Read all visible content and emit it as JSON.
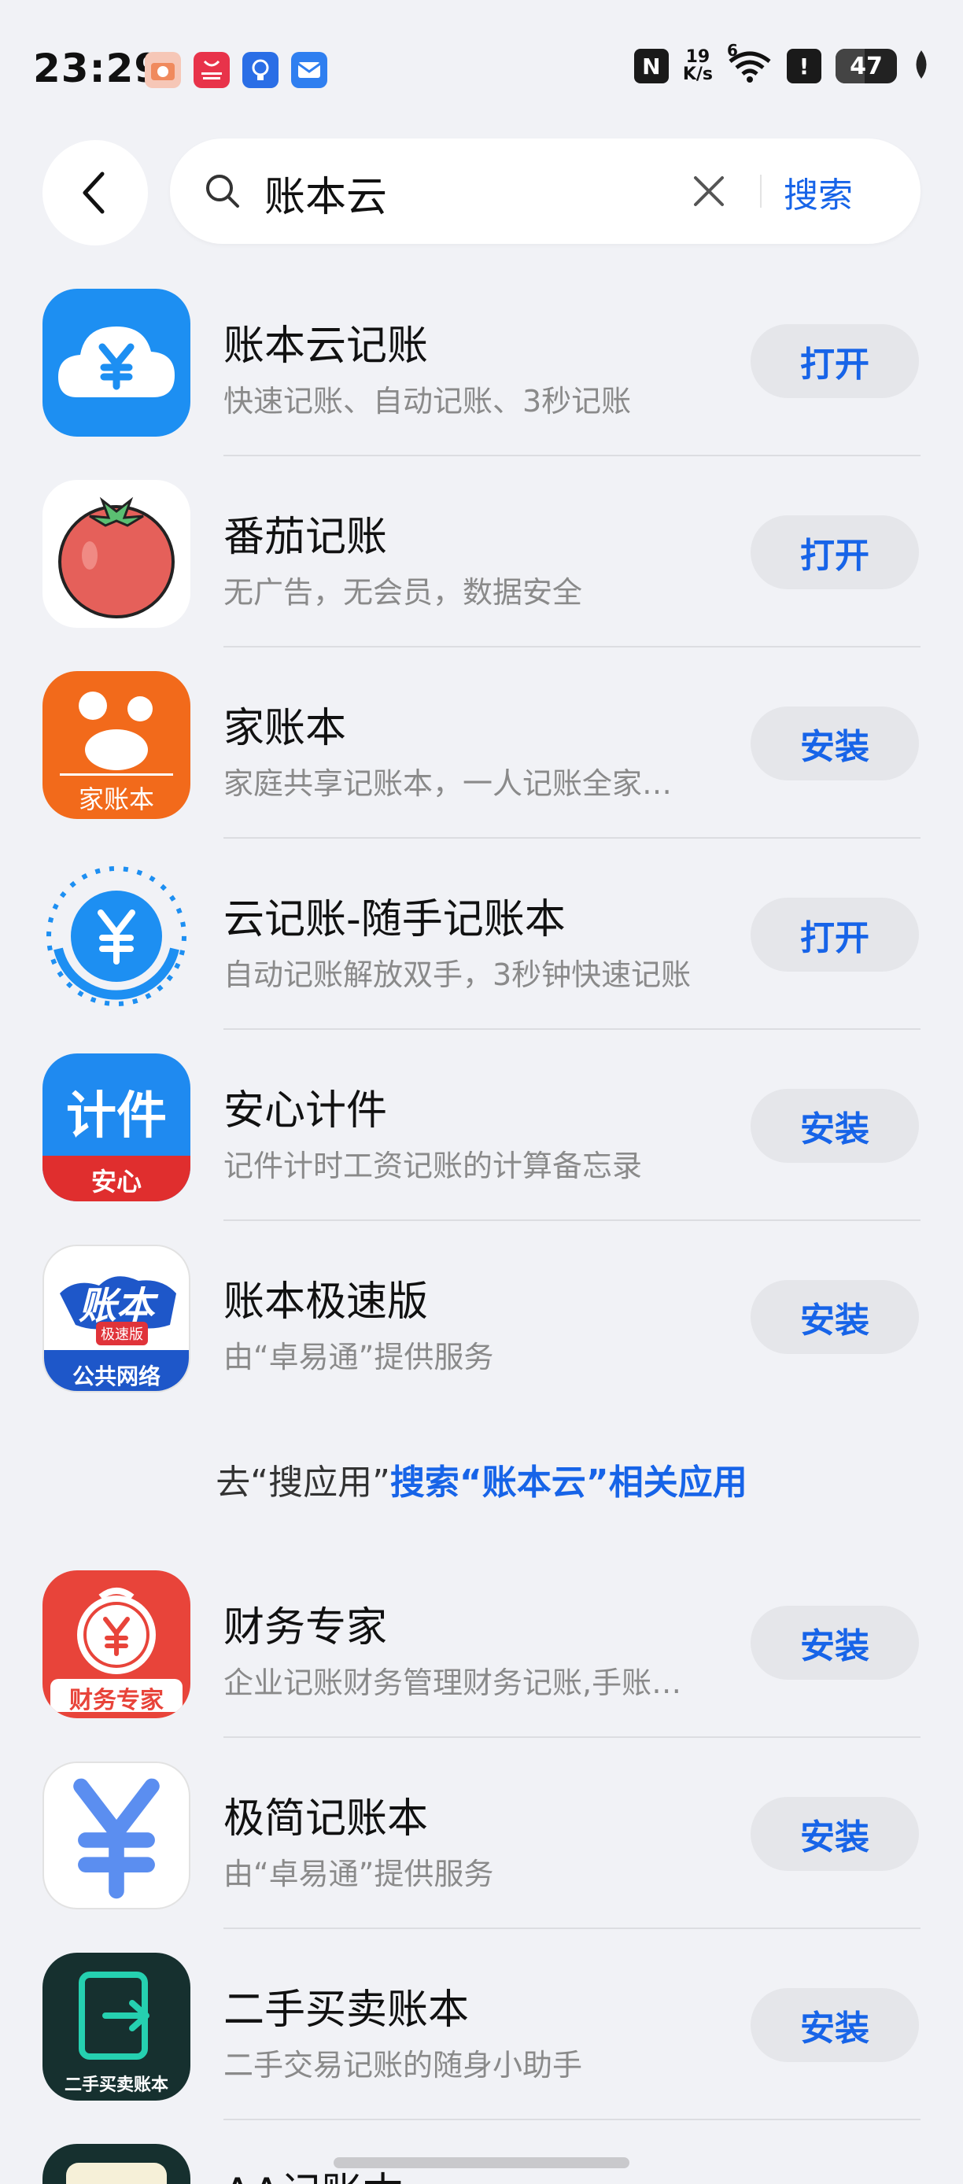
{
  "status_bar": {
    "time": "23:29",
    "notification_icons": [
      "camera-app-icon",
      "app-gallery-icon",
      "tips-icon",
      "email-icon"
    ],
    "nfc_label": "N",
    "net_speed_value": "19",
    "net_speed_unit": "K/s",
    "wifi_label": "6",
    "alert_label": "!",
    "battery_percent": "47"
  },
  "search": {
    "back_icon": "chevron-left-icon",
    "query": "账本云",
    "search_button": "搜索"
  },
  "results": [
    {
      "name": "账本云记账",
      "desc": "快速记账、自动记账、3秒记账",
      "action": "打开",
      "icon": "cloud-yen-icon"
    },
    {
      "name": "番茄记账",
      "desc": "无广告，无会员，数据安全",
      "action": "打开",
      "icon": "tomato-icon"
    },
    {
      "name": "家账本",
      "desc": "家庭共享记账本，一人记账全家…",
      "action": "安装",
      "icon": "family-piggybank-icon",
      "icon_text": "家账本"
    },
    {
      "name": "云记账-随手记账本",
      "desc": "自动记账解放双手，3秒钟快速记账",
      "action": "打开",
      "icon": "yen-circle-icon"
    },
    {
      "name": "安心计件",
      "desc": "记件计时工资记账的计算备忘录",
      "action": "安装",
      "icon": "piecework-icon",
      "icon_text": "计件",
      "icon_sub": "安心"
    },
    {
      "name": "账本极速版",
      "desc": "由“卓易通”提供服务",
      "action": "安装",
      "icon": "world-map-ledger-icon",
      "icon_text": "账本",
      "icon_badge": "极速版",
      "icon_sub": "公共网络"
    }
  ],
  "goto_search": {
    "prefix": "去“搜应用”",
    "link": "搜索“账本云”相关应用"
  },
  "related": [
    {
      "name": "财务专家",
      "desc": "企业记账财务管理财务记账,手账…",
      "action": "安装",
      "icon": "money-bag-icon",
      "icon_text": "财务专家"
    },
    {
      "name": "极简记账本",
      "desc": "由“卓易通”提供服务",
      "action": "安装",
      "icon": "yen-symbol-icon"
    },
    {
      "name": "二手买卖账本",
      "desc": "二手交易记账的随身小助手",
      "action": "安装",
      "icon": "exchange-icon",
      "icon_text": "二手买卖账本"
    },
    {
      "name": "AA记账本",
      "desc": "",
      "action": "",
      "icon": "partial-app-icon"
    }
  ],
  "colors": {
    "accent": "#1764e8",
    "background": "#f1f2f6",
    "button_bg": "#e5e6ea"
  }
}
